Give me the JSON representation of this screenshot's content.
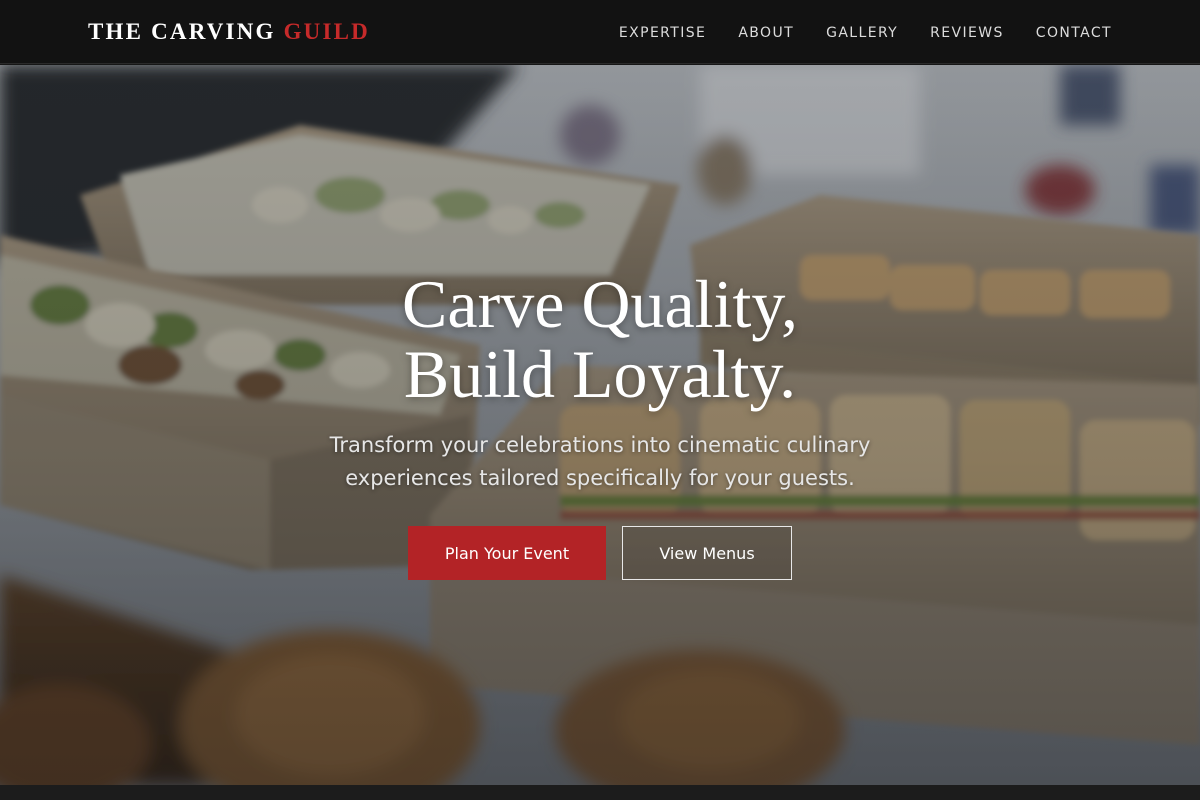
{
  "brand": {
    "name_main": "THE CARVING",
    "name_accent": "GUILD"
  },
  "nav": {
    "items": [
      {
        "label": "EXPERTISE"
      },
      {
        "label": "ABOUT"
      },
      {
        "label": "GALLERY"
      },
      {
        "label": "REVIEWS"
      },
      {
        "label": "CONTACT"
      }
    ]
  },
  "hero": {
    "title_line1": "Carve Quality,",
    "title_line2": "Build Loyalty.",
    "subtitle": "Transform your celebrations into cinematic culinary experiences tailored specifically for your guests.",
    "primary_cta": "Plan Your Event",
    "secondary_cta": "View Menus"
  },
  "colors": {
    "accent": "#b32326",
    "nav_bg": "#121212",
    "text": "#ffffff"
  }
}
